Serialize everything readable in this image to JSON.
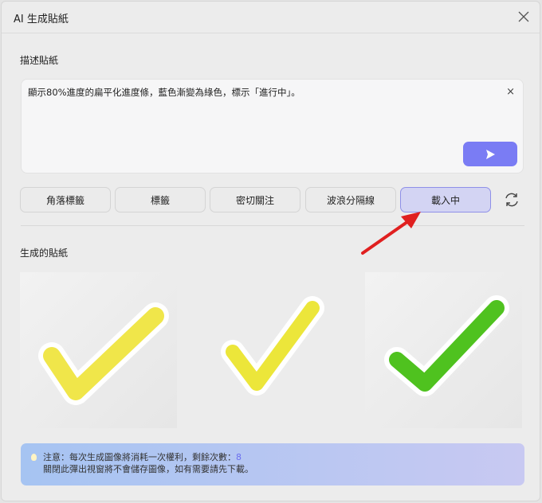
{
  "dialog": {
    "title": "AI 生成貼紙"
  },
  "describe": {
    "label": "描述貼紙",
    "value": "顯示80%進度的扁平化進度條，藍色漸變為綠色，標示「進行中」。",
    "clear": "×"
  },
  "chips": [
    {
      "label": "角落標籤"
    },
    {
      "label": "標籤"
    },
    {
      "label": "密切關注"
    },
    {
      "label": "波浪分隔線"
    },
    {
      "label": "載入中"
    }
  ],
  "generated": {
    "label": "生成的貼紙",
    "images": [
      {
        "color": "#f0e64a"
      },
      {
        "color": "#ece63a"
      },
      {
        "color": "#4fc21f"
      }
    ]
  },
  "notice": {
    "line1_prefix": "注意：每次生成圖像將消耗一次權利，剩餘次數：",
    "remaining": "8",
    "line2": "關閉此彈出視窗將不會儲存圖像，如有需要請先下載。"
  },
  "colors": {
    "accent": "#7a7cf4",
    "annotation": "#e02020"
  }
}
